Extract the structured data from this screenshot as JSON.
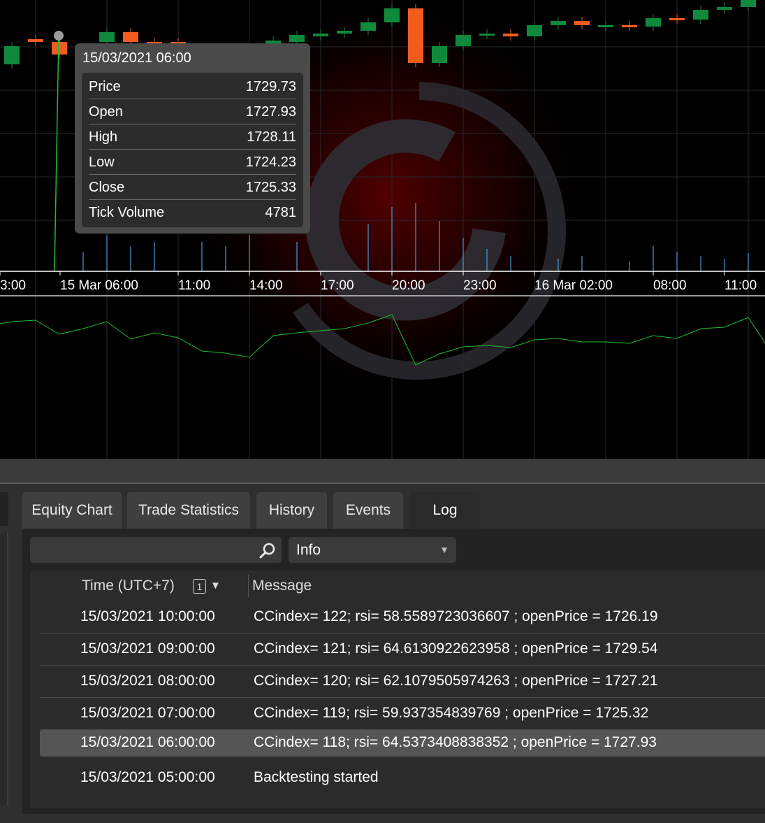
{
  "chart": {
    "time_axis_labels": [
      "3:00",
      "15 Mar 06:00",
      "11:00",
      "14:00",
      "17:00",
      "20:00",
      "23:00",
      "16 Mar 02:00",
      "08:00",
      "11:00"
    ],
    "colors": {
      "bull": "#0f8a3c",
      "bear": "#f25c1e",
      "volume": "#4a9bd4",
      "indicator": "#1dbf2a",
      "grid": "#262a2e",
      "axis": "#ffffff"
    }
  },
  "tooltip": {
    "datetime": "15/03/2021 06:00",
    "rows": [
      {
        "label": "Price",
        "value": "1729.73"
      },
      {
        "label": "Open",
        "value": "1727.93"
      },
      {
        "label": "High",
        "value": "1728.11"
      },
      {
        "label": "Low",
        "value": "1724.23"
      },
      {
        "label": "Close",
        "value": "1725.33"
      },
      {
        "label": "Tick Volume",
        "value": "4781"
      }
    ]
  },
  "tabs": [
    {
      "label": "Equity Chart",
      "active": false
    },
    {
      "label": "Trade Statistics",
      "active": false
    },
    {
      "label": "History",
      "active": false
    },
    {
      "label": "Events",
      "active": false
    },
    {
      "label": "Log",
      "active": true
    }
  ],
  "log": {
    "search": {
      "value": "",
      "placeholder": "",
      "icon": "search-icon"
    },
    "level": {
      "selected": "Info"
    },
    "columns": {
      "time": "Time (UTC+7)",
      "sort_order": "1",
      "message": "Message"
    },
    "rows": [
      {
        "time": "15/03/2021 10:00:00",
        "message": "CCindex= 122; rsi= 58.5589723036607 ; openPrice = 1726.19"
      },
      {
        "time": "15/03/2021 09:00:00",
        "message": "CCindex= 121; rsi= 64.6130922623958 ; openPrice = 1729.54"
      },
      {
        "time": "15/03/2021 08:00:00",
        "message": "CCindex= 120; rsi= 62.1079505974263 ; openPrice = 1727.21"
      },
      {
        "time": "15/03/2021 07:00:00",
        "message": "CCindex= 119; rsi= 59.937354839769 ; openPrice = 1725.32"
      },
      {
        "time": "15/03/2021 06:00:00",
        "message": "CCindex= 118; rsi= 64.5373408838352 ; openPrice = 1727.93",
        "selected": true
      },
      {
        "time": "15/03/2021 05:00:00",
        "message": "Backtesting started"
      }
    ]
  }
}
